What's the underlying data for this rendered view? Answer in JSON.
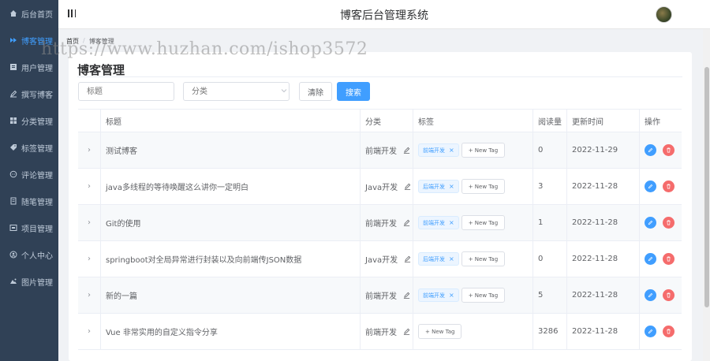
{
  "header": {
    "title": "博客后台管理系统"
  },
  "sidebar": {
    "items": [
      {
        "label": "后台首页",
        "icon": "home-icon",
        "active": false
      },
      {
        "label": "博客管理",
        "icon": "blog-icon",
        "active": true
      },
      {
        "label": "用户管理",
        "icon": "user-list-icon",
        "active": false
      },
      {
        "label": "撰写博客",
        "icon": "pen-icon",
        "active": false
      },
      {
        "label": "分类管理",
        "icon": "grid-icon",
        "active": false
      },
      {
        "label": "标签管理",
        "icon": "tag-icon",
        "active": false
      },
      {
        "label": "评论管理",
        "icon": "comment-icon",
        "active": false
      },
      {
        "label": "随笔管理",
        "icon": "note-icon",
        "active": false
      },
      {
        "label": "项目管理",
        "icon": "project-icon",
        "active": false
      },
      {
        "label": "个人中心",
        "icon": "person-icon",
        "active": false
      },
      {
        "label": "图片管理",
        "icon": "image-icon",
        "active": false
      }
    ]
  },
  "breadcrumb": {
    "home": "首页",
    "separator": "/",
    "current": "博客管理"
  },
  "watermark": "https://www.huzhan.com/ishop3572",
  "main": {
    "page_title": "博客管理",
    "filters": {
      "title_placeholder": "标题",
      "category_placeholder": "分类",
      "clear_label": "清除",
      "search_label": "搜索"
    },
    "table": {
      "columns": [
        "标题",
        "分类",
        "标签",
        "阅读量",
        "更新时间",
        "操作"
      ],
      "new_tag_label": "+ New Tag",
      "rows": [
        {
          "title": "测试博客",
          "category": "前端开发",
          "tags": [
            "前端开发"
          ],
          "views": "0",
          "updated": "2022-11-29"
        },
        {
          "title": "java多线程的等待唤醒这么讲你一定明白",
          "category": "Java开发",
          "tags": [
            "后端开发"
          ],
          "views": "3",
          "updated": "2022-11-28"
        },
        {
          "title": "Git的使用",
          "category": "前端开发",
          "tags": [
            "前端开发"
          ],
          "views": "1",
          "updated": "2022-11-28"
        },
        {
          "title": "springboot对全局异常进行封装以及向前端传JSON数据",
          "category": "Java开发",
          "tags": [
            "后端开发"
          ],
          "views": "0",
          "updated": "2022-11-28"
        },
        {
          "title": "新的一篇",
          "category": "前端开发",
          "tags": [
            "前端开发"
          ],
          "views": "5",
          "updated": "2022-11-28"
        },
        {
          "title": "Vue 非常实用的自定义指令分享",
          "category": "前端开发",
          "tags": [],
          "views": "3286",
          "updated": "2022-11-28"
        }
      ]
    }
  },
  "colors": {
    "sidebar_bg": "#304156",
    "accent": "#409eff",
    "danger": "#f56c6c"
  }
}
